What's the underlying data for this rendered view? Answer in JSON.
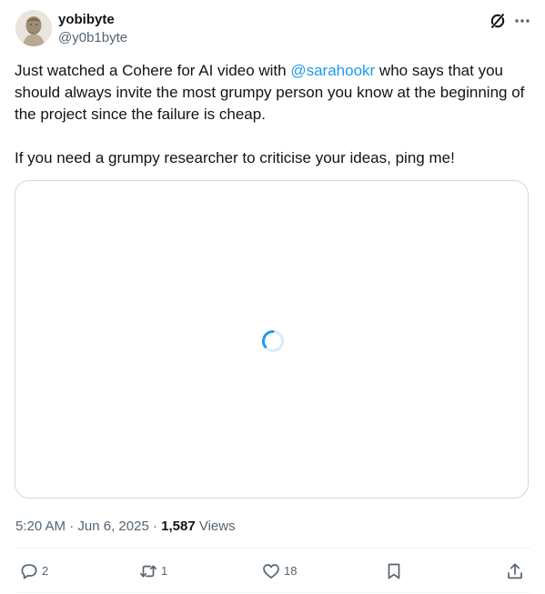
{
  "author": {
    "name": "yobibyte",
    "handle": "@y0b1byte",
    "avatar_icon": "bust-statue-avatar"
  },
  "header_icons": {
    "grok": "grok-slash-icon",
    "more": "more-dots-icon"
  },
  "tweet": {
    "line1_prefix": "Just watched a Cohere for AI video with ",
    "mention": "@sarahookr",
    "line1_suffix": " who says that you should always invite the most grumpy person you know at the beginning of the project since the failure is cheap.",
    "paragraph2": "If you need a grumpy researcher to criticise your ideas, ping me!"
  },
  "media": {
    "state": "loading",
    "spinner_icon": "loading-spinner-icon"
  },
  "meta": {
    "time": "5:20 AM",
    "separator1": " · ",
    "date": "Jun 6, 2025",
    "separator2": " · ",
    "views_count": "1,587",
    "views_label": " Views"
  },
  "actions": {
    "replies": "2",
    "reposts": "1",
    "likes": "18"
  },
  "colors": {
    "accent": "#1d9bf0",
    "text": "#0f1419",
    "secondary": "#536471",
    "border": "#cfd9de"
  }
}
